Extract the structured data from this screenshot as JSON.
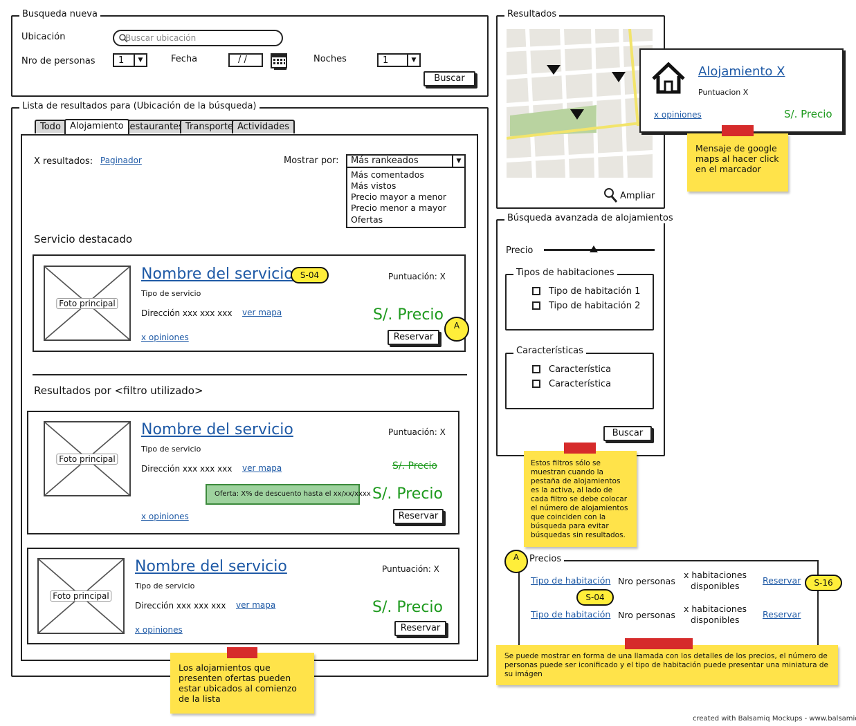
{
  "search": {
    "legend": "Busqueda nueva",
    "location_label": "Ubicación",
    "location_placeholder": "Buscar ubicación",
    "persons_label": "Nro de personas",
    "persons_value": "1",
    "date_label": "Fecha",
    "date_value": "/ /",
    "nights_label": "Noches",
    "nights_value": "1",
    "search_button": "Buscar"
  },
  "results_list": {
    "legend": "Lista de resultados para (Ubicación de la búsqueda)",
    "tabs": [
      {
        "label": "Todo"
      },
      {
        "label": "Alojamiento"
      },
      {
        "label": "Restaurantes"
      },
      {
        "label": "Transporte"
      },
      {
        "label": "Actividades"
      }
    ],
    "count_label": "X resultados:",
    "paginator": "Paginador",
    "sort_label": "Mostrar por:",
    "sort_selected": "Más rankeados",
    "sort_options": [
      "Más comentados",
      "Más vistos",
      "Precio mayor a menor",
      "Precio menor a mayor",
      "Ofertas"
    ],
    "featured_heading": "Servicio destacado",
    "filter_heading": "Resultados por <filtro utilizado>",
    "items": [
      {
        "photo": "Foto principal",
        "name": "Nombre del servicio",
        "type": "Tipo de servicio",
        "address": "Dirección xxx xxx xxx",
        "map_link": "ver mapa",
        "opinions": "x opiniones",
        "score": "Puntuación: X",
        "price": "S/. Precio",
        "reserve": "Reservar",
        "badge": "S-04",
        "badge2": "A"
      },
      {
        "photo": "Foto principal",
        "name": "Nombre del servicio",
        "type": "Tipo de servicio",
        "address": "Dirección xxx xxx xxx",
        "map_link": "ver mapa",
        "opinions": "x opiniones",
        "score": "Puntuación: X",
        "old_price": "S/. Precio",
        "offer": "Oferta: X% de descuento hasta el xx/xx/xxxx",
        "price": "S/. Precio",
        "reserve": "Reservar"
      },
      {
        "photo": "Foto principal",
        "name": "Nombre del servicio",
        "type": "Tipo de servicio",
        "address": "Dirección xxx xxx xxx",
        "map_link": "ver mapa",
        "opinions": "x opiniones",
        "score": "Puntuación: X",
        "price": "S/. Precio",
        "reserve": "Reservar"
      }
    ]
  },
  "map_panel": {
    "legend": "Resultados",
    "zoom_label": "Ampliar",
    "popup": {
      "title": "Alojamiento X",
      "score": "Puntuacion X",
      "opinions": "x opiniones",
      "price": "S/. Precio"
    }
  },
  "advanced": {
    "legend": "Búsqueda avanzada de alojamientos",
    "price_label": "Precio",
    "price_slider_level": 0.45,
    "room_types_legend": "Tipos de habitaciones",
    "room_types": [
      "Tipo de habitación 1",
      "Tipo de habitación 2"
    ],
    "features_legend": "Características",
    "features": [
      "Característica",
      "Característica"
    ],
    "search_button": "Buscar"
  },
  "prices": {
    "legend": "Precios",
    "badge": "A",
    "rows": [
      {
        "room": "Tipo de habitación",
        "persons": "Nro personas",
        "avail1": "x habitaciones",
        "avail2": "disponibles",
        "reserve": "Reservar"
      },
      {
        "room": "Tipo de habitación",
        "persons": "Nro personas",
        "avail1": "x habitaciones",
        "avail2": "disponibles",
        "reserve": "Reservar"
      }
    ],
    "badge_s04": "S-04",
    "badge_s16": "S-16"
  },
  "notes": {
    "google_maps": "Mensaje de google maps al hacer click en el marcador",
    "filters": "Estos filtros sólo se muestran cuando la pestaña de alojamientos es la activa, al lado de cada filtro se debe colocar el número de alojamientos que coinciden con la búsqueda para evitar búsquedas sin resultados.",
    "offers": "Los alojamientos que presenten ofertas pueden estar ubicados al comienzo de la lista",
    "prices_callout": "Se puede mostrar en forma de una llamada con los detalles de los precios, el número de personas puede ser iconificado y el tipo de habitación puede presentar una miniatura de su imágen"
  },
  "footer": "created with Balsamiq Mockups - www.balsamiq.com",
  "colors": {
    "link": "#1f5aa6",
    "price": "#1e9a1e",
    "sticky": "#ffe34a",
    "tape": "#d62b2b",
    "offer_bg": "#9ed29e"
  }
}
